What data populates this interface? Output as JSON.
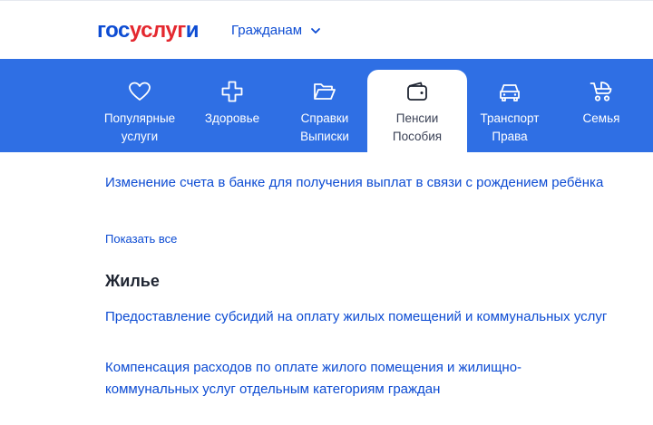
{
  "header": {
    "logo_gos": "гос",
    "logo_usl": "услуг",
    "logo_u": "и",
    "audience_label": "Гражданам"
  },
  "nav": {
    "items": [
      {
        "line1": "Популярные",
        "line2": "услуги",
        "icon": "heart-icon"
      },
      {
        "line1": "Здоровье",
        "line2": "",
        "icon": "cross-icon"
      },
      {
        "line1": "Справки",
        "line2": "Выписки",
        "icon": "folder-icon"
      },
      {
        "line1": "Пенсии",
        "line2": "Пособия",
        "icon": "wallet-icon",
        "active": true
      },
      {
        "line1": "Транспорт",
        "line2": "Права",
        "icon": "car-icon"
      },
      {
        "line1": "Семья",
        "line2": "",
        "icon": "stroller-icon"
      }
    ]
  },
  "content": {
    "cut_link": "Изменение счета в банке для получения выплат в связи с рождением ребёнка",
    "show_all": "Показать все",
    "section_title": "Жилье",
    "links": [
      "Предоставление субсидий на оплату жилых помещений и коммунальных услуг",
      "Компенсация расходов по оплате жилого помещения и жилищно-коммунальных услуг отдельным категориям граждан"
    ]
  },
  "colors": {
    "brand_blue": "#0d4cd3",
    "brand_red": "#e4282f",
    "nav_bg": "#2f6fe4"
  }
}
